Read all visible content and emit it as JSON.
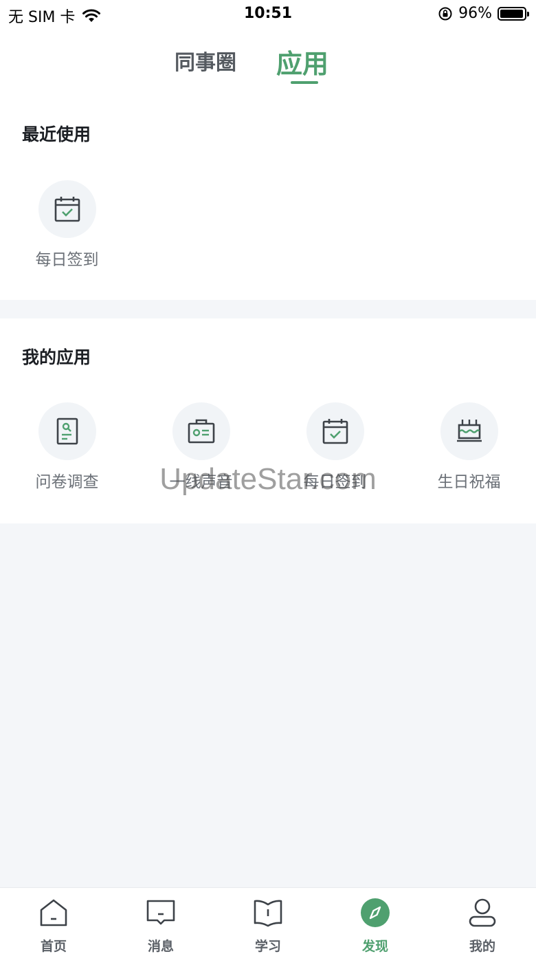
{
  "status_bar": {
    "carrier": "无 SIM 卡",
    "time": "10:51",
    "battery_percent": "96%",
    "battery_level": 0.96
  },
  "header": {
    "tabs": [
      {
        "label": "同事圈",
        "active": false
      },
      {
        "label": "应用",
        "active": true
      }
    ]
  },
  "recent": {
    "title": "最近使用",
    "items": [
      {
        "label": "每日签到",
        "icon": "calendar-check-icon"
      }
    ]
  },
  "my_apps": {
    "title": "我的应用",
    "items": [
      {
        "label": "问卷调查",
        "icon": "survey-icon"
      },
      {
        "label": "一线声音",
        "icon": "id-card-icon"
      },
      {
        "label": "每日签到",
        "icon": "calendar-check-icon"
      },
      {
        "label": "生日祝福",
        "icon": "cake-icon"
      }
    ]
  },
  "watermark": "UpdateStar.com",
  "bottom_nav": {
    "items": [
      {
        "label": "首页",
        "icon": "home-icon",
        "active": false
      },
      {
        "label": "消息",
        "icon": "message-icon",
        "active": false
      },
      {
        "label": "学习",
        "icon": "book-icon",
        "active": false
      },
      {
        "label": "发现",
        "icon": "compass-icon",
        "active": true
      },
      {
        "label": "我的",
        "icon": "user-icon",
        "active": false
      }
    ]
  },
  "colors": {
    "accent": "#4fa06f",
    "background": "#f4f6f9",
    "icon_bg": "#f1f4f7",
    "text_muted": "#6b7077"
  }
}
